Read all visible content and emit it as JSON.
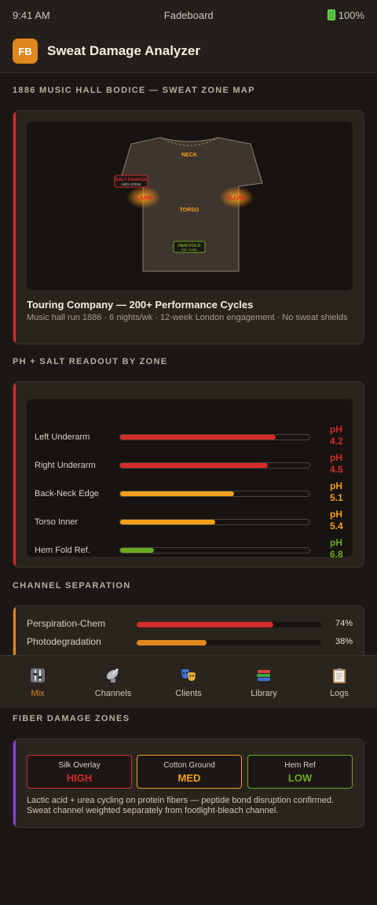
{
  "status": {
    "time": "9:41 AM",
    "carrier": "Fadeboard",
    "battery": "100%"
  },
  "app": {
    "logo": "FB",
    "title": "Sweat Damage Analyzer"
  },
  "sections": {
    "map": "1886 MUSIC HALL BODICE — SWEAT ZONE MAP",
    "readout": "PH + SALT READOUT BY ZONE",
    "channel": "CHANNEL SEPARATION",
    "fiber": "FIBER DAMAGE ZONES"
  },
  "map": {
    "labels": {
      "neck": "NECK",
      "salt_damage": "SALT DAMAGE",
      "high_zone": "HIGH ZONE",
      "left_underarm": "L.ARM",
      "right_underarm": "R.ARM",
      "torso": "TORSO",
      "hem_fold": "HEM FOLD",
      "ref_zone": "REF ZONE"
    },
    "caption_title": "Touring Company — 200+ Performance Cycles",
    "caption_sub": "Music hall run 1886 · 6 nights/wk · 12-week London engagement · No sweat shields"
  },
  "readout": [
    {
      "label": "Left Underarm",
      "ph_prefix": "pH",
      "ph": "4.2",
      "level": 0.82,
      "color": "#d62b2b"
    },
    {
      "label": "Right Underarm",
      "ph_prefix": "pH",
      "ph": "4.5",
      "level": 0.78,
      "color": "#d62b2b"
    },
    {
      "label": "Back-Neck Edge",
      "ph_prefix": "pH",
      "ph": "5.1",
      "level": 0.6,
      "color": "#f2a01a"
    },
    {
      "label": "Torso Inner",
      "ph_prefix": "pH",
      "ph": "5.4",
      "level": 0.5,
      "color": "#f2a01a"
    },
    {
      "label": "Hem Fold Ref.",
      "ph_prefix": "pH",
      "ph": "6.8",
      "level": 0.18,
      "color": "#6aaa1e"
    }
  ],
  "channels": [
    {
      "label": "Perspiration-Chem",
      "pct": "74%",
      "level": 0.74,
      "color": "#d62b2b"
    },
    {
      "label": "Photodegradation",
      "pct": "38%",
      "level": 0.38,
      "color": "#e0871e"
    }
  ],
  "tabs": [
    {
      "label": "Mix",
      "icon": "mixer-icon",
      "active": true
    },
    {
      "label": "Channels",
      "icon": "satellite-icon",
      "active": false
    },
    {
      "label": "Clients",
      "icon": "masks-icon",
      "active": false
    },
    {
      "label": "Library",
      "icon": "books-icon",
      "active": false
    },
    {
      "label": "Logs",
      "icon": "clipboard-icon",
      "active": false
    }
  ],
  "fiber": {
    "zones": [
      {
        "name": "Silk Overlay",
        "level": "HIGH",
        "color": "#d62b2b"
      },
      {
        "name": "Cotton Ground",
        "level": "MED",
        "color": "#f2a01a"
      },
      {
        "name": "Hem Ref",
        "level": "LOW",
        "color": "#6aaa1e"
      }
    ],
    "note": "Lactic acid + urea cycling on protein fibers — peptide bond disruption confirmed. Sweat channel weighted separately from footlight-bleach channel."
  },
  "colors": {
    "accent": "#e0871e",
    "background": "#1b1714",
    "card": "#2a241f"
  }
}
